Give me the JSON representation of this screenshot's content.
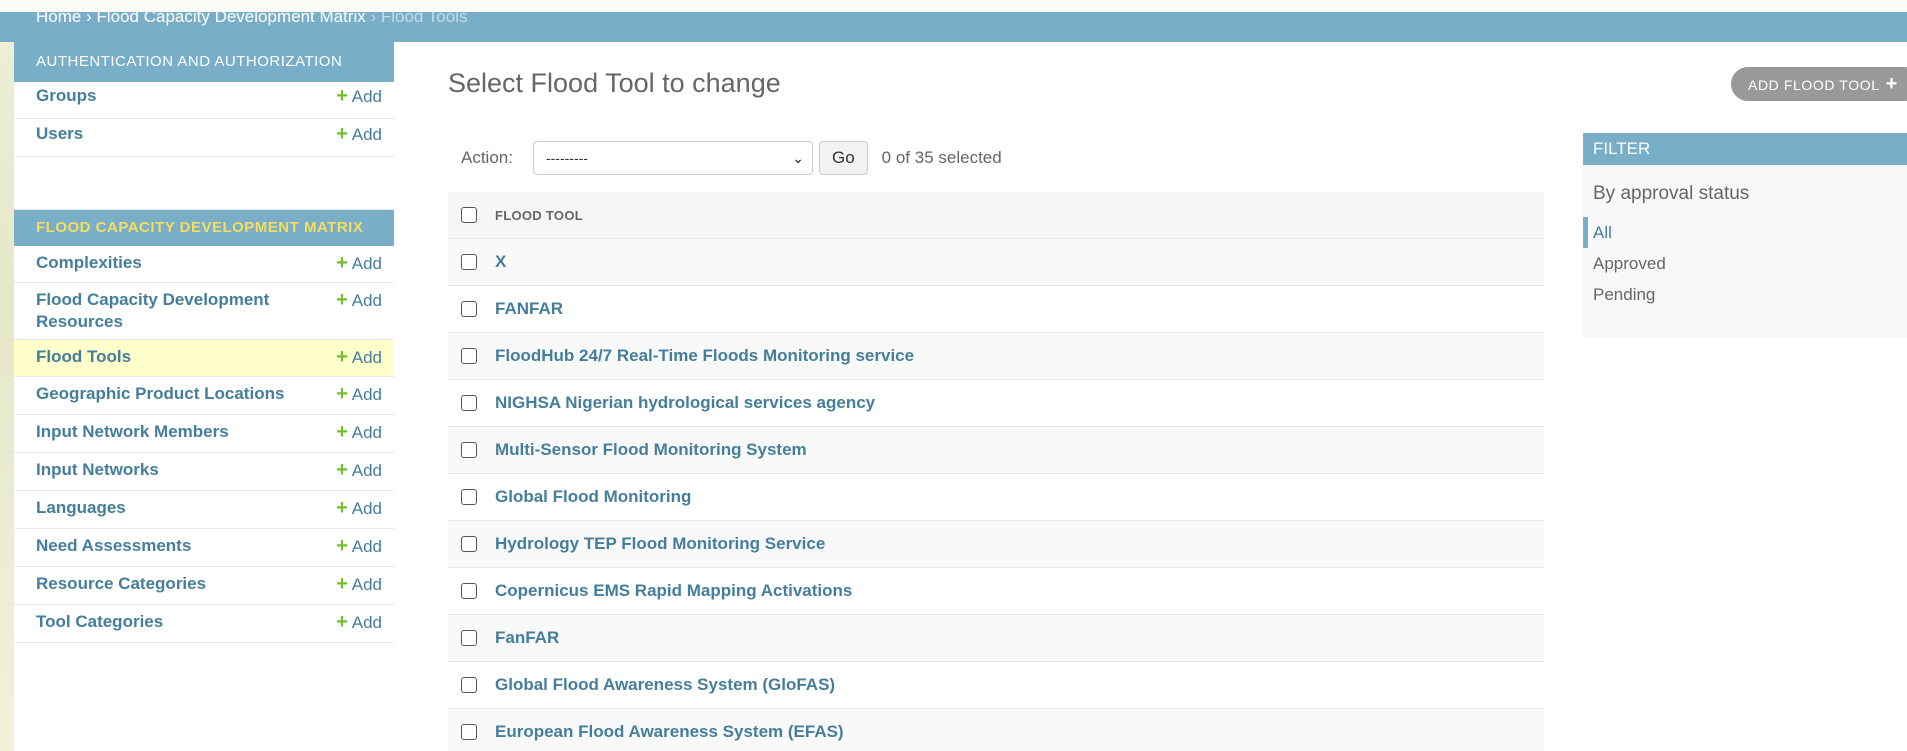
{
  "breadcrumbs": {
    "home": "Home",
    "separator1": " › ",
    "section": "Flood Capacity Development Matrix",
    "separator2": " › ",
    "current": "Flood Tools"
  },
  "sidebar": {
    "modules": [
      {
        "caption": "Authentication and Authorization",
        "models": [
          {
            "name": "Groups",
            "add_label": "Add"
          },
          {
            "name": "Users",
            "add_label": "Add"
          }
        ]
      },
      {
        "caption": "Flood Capacity Development Matrix",
        "models": [
          {
            "name": "Complexities",
            "add_label": "Add"
          },
          {
            "name": "Flood Capacity Development Resources",
            "add_label": "Add"
          },
          {
            "name": "Flood Tools",
            "add_label": "Add",
            "current": true
          },
          {
            "name": "Geographic Product Locations",
            "add_label": "Add"
          },
          {
            "name": "Input Network Members",
            "add_label": "Add"
          },
          {
            "name": "Input Networks",
            "add_label": "Add"
          },
          {
            "name": "Languages",
            "add_label": "Add"
          },
          {
            "name": "Need Assessments",
            "add_label": "Add"
          },
          {
            "name": "Resource Categories",
            "add_label": "Add"
          },
          {
            "name": "Tool Categories",
            "add_label": "Add"
          }
        ]
      }
    ]
  },
  "content": {
    "title": "Select Flood Tool to change",
    "add_button_label": "Add Flood Tool",
    "actions": {
      "label": "Action:",
      "selected_option": "---------",
      "go_label": "Go",
      "counter": "0 of 35 selected"
    },
    "table": {
      "column_header": "Flood Tool",
      "rows": [
        "X",
        "FANFAR",
        "FloodHub 24/7 Real-Time Floods Monitoring service",
        "NIGHSA Nigerian hydrological services agency",
        "Multi-Sensor Flood Monitoring System",
        "Global Flood Monitoring",
        "Hydrology TEP Flood Monitoring Service",
        "Copernicus EMS Rapid Mapping Activations",
        "FanFAR",
        "Global Flood Awareness System (GloFAS)",
        "European Flood Awareness System (EFAS)"
      ]
    }
  },
  "filter": {
    "caption": "Filter",
    "heading": "By approval status",
    "options": [
      {
        "label": "All",
        "selected": true
      },
      {
        "label": "Approved",
        "selected": false
      },
      {
        "label": "Pending",
        "selected": false
      }
    ]
  },
  "colors": {
    "header_blue": "#79aec8",
    "link_blue": "#447e9b",
    "add_green": "#70bf2b",
    "module_caption_yellow": "#f5dd5d",
    "current_row_highlight": "#ffffcc"
  },
  "icons": {
    "add": "plus-icon",
    "select": "chevron-down-icon",
    "checkbox": "checkbox-icon"
  }
}
